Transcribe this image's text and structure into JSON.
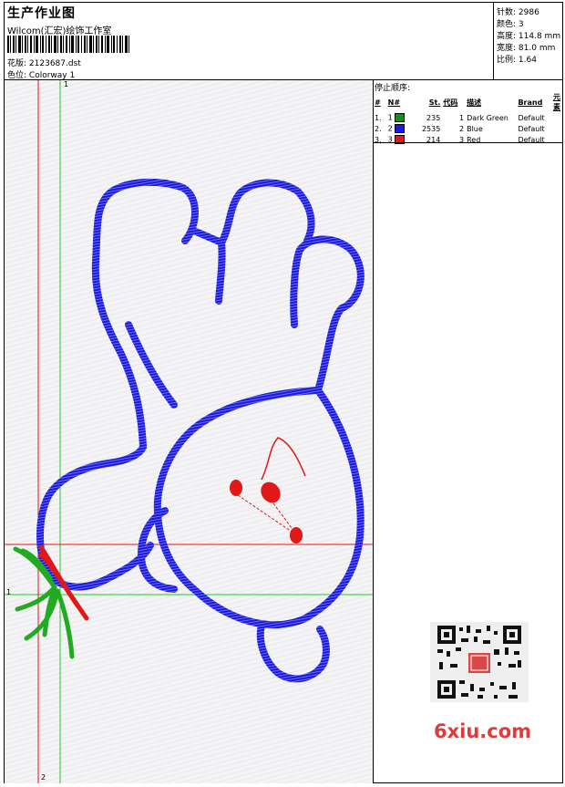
{
  "header": {
    "title": "生产作业图",
    "company": "Wilcom(汇宏)绘饰工作室",
    "design_label": "花版:",
    "design_file": "2123687.dst",
    "colorway_label": "色位:",
    "colorway": "Colorway 1"
  },
  "stats": [
    {
      "label": "针数:",
      "value": "2986"
    },
    {
      "label": "颜色:",
      "value": "3"
    },
    {
      "label": "高度:",
      "value": "114.8 mm"
    },
    {
      "label": "宽度:",
      "value": "81.0 mm"
    },
    {
      "label": "比例:",
      "value": "1.64"
    }
  ],
  "stop_sequence": {
    "title": "停止顺序:",
    "headers": [
      "#",
      "N#",
      "St.",
      "代码",
      "描述",
      "Brand",
      "元素"
    ],
    "rows": [
      {
        "num": "1.",
        "n": "1",
        "color": "#1a8a1a",
        "st": "235",
        "code": "1",
        "desc": "Dark Green",
        "brand": "Default"
      },
      {
        "num": "2.",
        "n": "2",
        "color": "#1a1ae0",
        "st": "2535",
        "code": "2",
        "desc": "Blue",
        "brand": "Default"
      },
      {
        "num": "3.",
        "n": "3",
        "color": "#e01a1a",
        "st": "214",
        "code": "3",
        "desc": "Red",
        "brand": "Default"
      }
    ]
  },
  "axes": {
    "green_label_top": "1",
    "green_label_left": "1",
    "red_label_bottom": "2"
  },
  "watermark": "6xiu.com",
  "colors": {
    "green": "#22aa22",
    "blue": "#1a1ad8",
    "red": "#e01818"
  }
}
